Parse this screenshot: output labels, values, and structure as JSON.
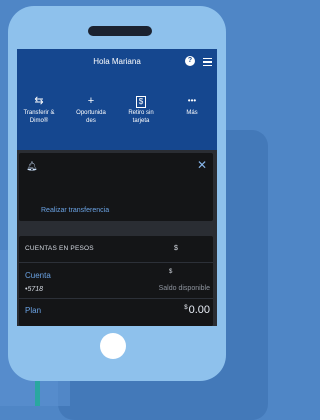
{
  "header": {
    "greeting": "Hola Mariana",
    "help_icon": "question-circle-icon",
    "menu_icon": "hamburger-menu-icon"
  },
  "actions": [
    {
      "icon": "⇆",
      "icon_name": "transfer-arrows-icon",
      "label_line1": "Transferir &",
      "label_line2": "Dimo®"
    },
    {
      "icon": "+",
      "icon_name": "plus-icon",
      "label_line1": "Oportunida",
      "label_line2": "des"
    },
    {
      "icon": "$",
      "icon_name": "dollar-card-icon",
      "label_line1": "Retiro sin",
      "label_line2": "tarjeta"
    },
    {
      "icon": "•••",
      "icon_name": "more-dots-icon",
      "label_line1": "Más",
      "label_line2": ""
    }
  ],
  "notice": {
    "bell_icon": "bell-icon",
    "close_icon": "close-icon",
    "link": "Realizar transferencia"
  },
  "accounts": {
    "heading": "CUENTAS EN PESOS",
    "heading_currency": "$",
    "account_name": "Cuenta",
    "account_number": "•5718",
    "account_currency": "$",
    "account_balance_label": "Saldo disponible",
    "plan_name": "Plan",
    "plan_currency": "$",
    "plan_amount": "0.00"
  },
  "colors": {
    "background": "#4f86c6",
    "phone": "#8ec1ec",
    "header": "#15478f",
    "link": "#6aa2e3"
  }
}
